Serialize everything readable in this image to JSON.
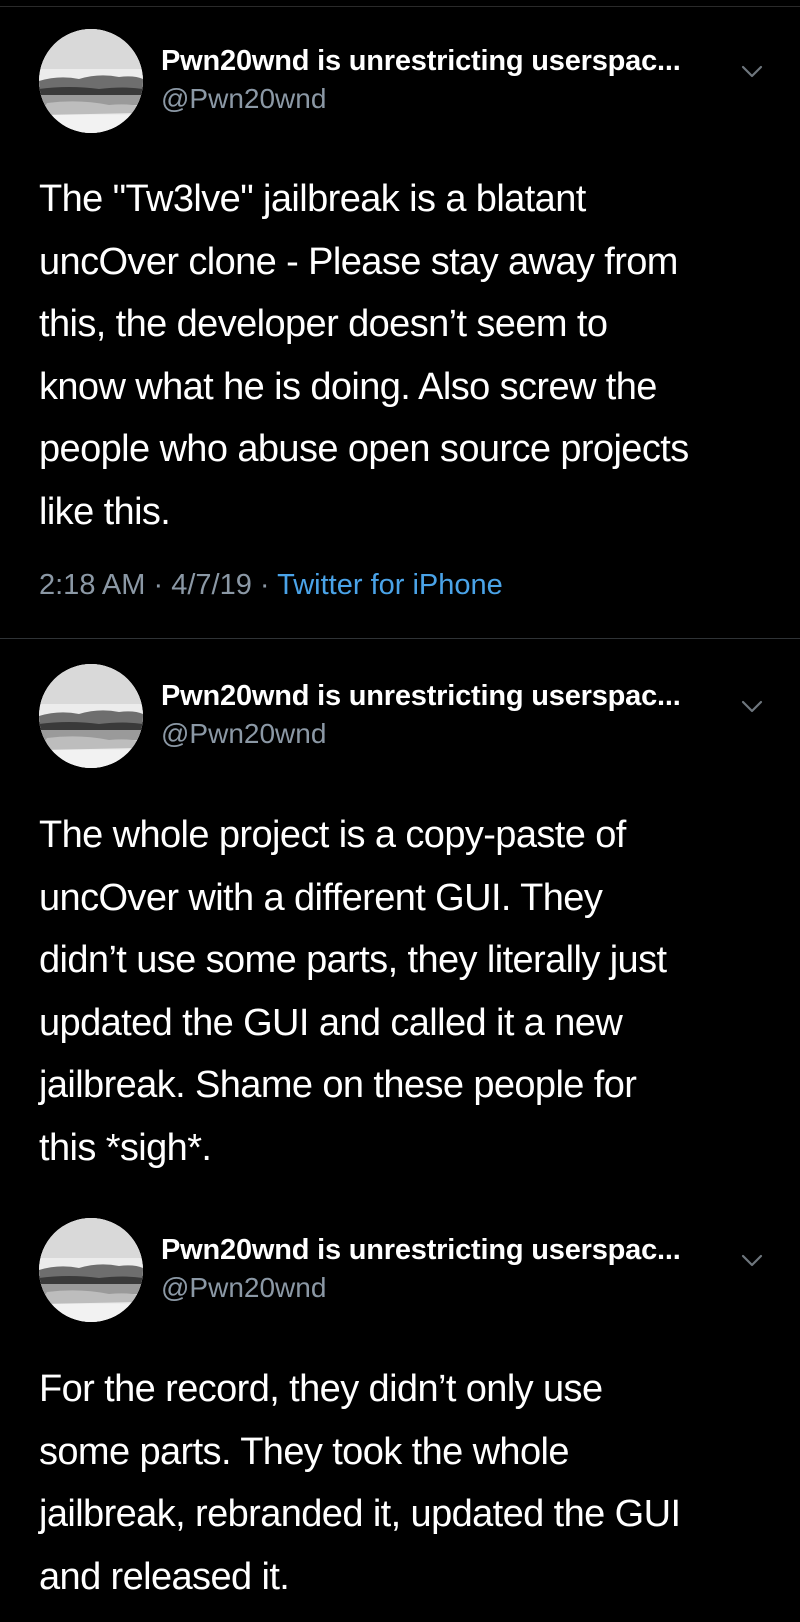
{
  "colors": {
    "background": "#000000",
    "text": "#ffffff",
    "secondary": "#8b98a5",
    "link": "#4aa3e8",
    "divider": "#2f3336"
  },
  "tweets": [
    {
      "display_name": "Pwn20wnd is unrestricting userspac...",
      "handle": "@Pwn20wnd",
      "text": "The \"Tw3lve\" jailbreak is a blatant\nuncOver clone - Please stay away from\nthis, the developer doesn’t seem to\nknow what he is doing. Also screw the\npeople who abuse open source projects\nlike this.",
      "time": "2:18 AM",
      "date": "4/7/19",
      "source": "Twitter for iPhone",
      "separator": "·",
      "avatar_icon": "avatar-landscape-icon",
      "menu_icon": "chevron-down-icon"
    },
    {
      "display_name": "Pwn20wnd is unrestricting userspac...",
      "handle": "@Pwn20wnd",
      "text": "The whole project is a copy-paste of\nuncOver with a different GUI. They\ndidn’t use some parts, they literally just\nupdated the GUI and called it a new\njailbreak. Shame on these people for\nthis *sigh*.",
      "avatar_icon": "avatar-landscape-icon",
      "menu_icon": "chevron-down-icon"
    },
    {
      "display_name": "Pwn20wnd is unrestricting userspac...",
      "handle": "@Pwn20wnd",
      "text": "For the record, they didn’t only use\nsome parts. They took the whole\njailbreak, rebranded it, updated the GUI\nand released it.",
      "avatar_icon": "avatar-landscape-icon",
      "menu_icon": "chevron-down-icon"
    }
  ]
}
